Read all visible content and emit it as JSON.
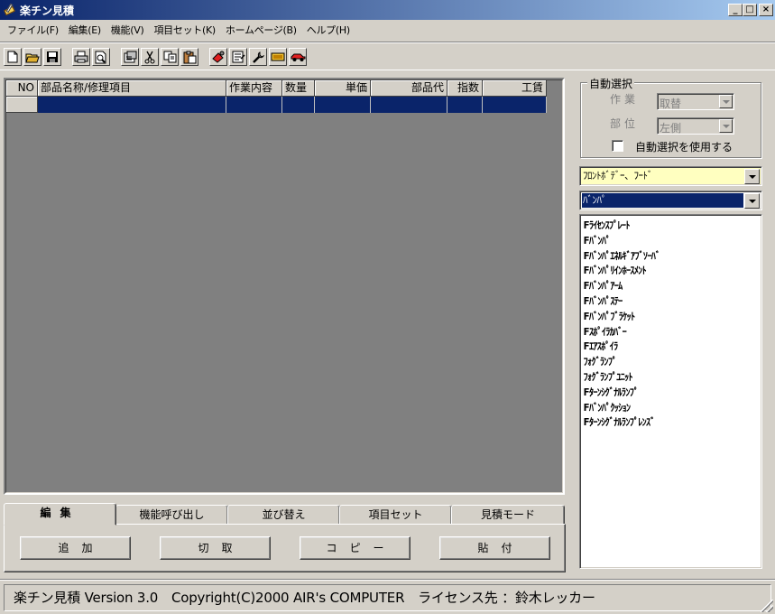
{
  "window": {
    "title": "楽チン見積",
    "minimize": "_",
    "maximize": "□",
    "close": "×"
  },
  "menu": [
    "ファイル(F)",
    "編集(E)",
    "機能(V)",
    "項目セット(K)",
    "ホームページ(B)",
    "ヘルプ(H)"
  ],
  "toolbar": {
    "icons": [
      "new-file-icon",
      "open-folder-icon",
      "save-disk-icon",
      "print-icon",
      "print-preview-icon",
      "properties-icon",
      "cut-icon",
      "copy-icon",
      "paste-icon",
      "paint-icon",
      "form-icon",
      "tool-wrench-icon",
      "price-icon",
      "car-icon"
    ]
  },
  "grid": {
    "columns": [
      "NO",
      "部品名称/修理項目",
      "作業内容",
      "数量",
      "単価",
      "部品代",
      "指数",
      "工賃"
    ]
  },
  "auto_select": {
    "title": "自動選択",
    "work_label": "作業",
    "work_value": "取替",
    "position_label": "部位",
    "position_value": "左側",
    "checkbox_label": "自動選択を使用する"
  },
  "category_combo": "ﾌﾛﾝﾄﾎﾞﾃﾞｰ、ﾌｰﾄﾞ",
  "sub_combo": "ﾊﾞﾝﾊﾟ",
  "parts_list": [
    "Fﾗｲｾﾝｽﾌﾟﾚｰﾄ",
    "Fﾊﾞﾝﾊﾟ",
    "Fﾊﾞﾝﾊﾟｴﾈﾙｷﾞｱﾌﾞｿｰﾊﾞ",
    "Fﾊﾞﾝﾊﾟﾘｲﾝﾎｰｽﾒﾝﾄ",
    "Fﾊﾞﾝﾊﾟｱｰﾑ",
    "Fﾊﾞﾝﾊﾟｽﾃｰ",
    "Fﾊﾞﾝﾊﾟﾌﾞﾗｹｯﾄ",
    "Fｽﾎﾟｲﾗｶﾊﾞｰ",
    "Fｴｱｽﾎﾟｲﾗ",
    "ﾌｫｸﾞﾗﾝﾌﾟ",
    "ﾌｫｸﾞﾗﾝﾌﾟﾕﾆｯﾄ",
    "Fﾀｰﾝｼｸﾞﾅﾙﾗﾝﾌﾟ",
    "Fﾊﾞﾝﾊﾟｸｯｼｮﾝ",
    "Fﾀｰﾝｼｸﾞﾅﾙﾗﾝﾌﾟﾚﾝｽﾞ"
  ],
  "tabs": [
    "編集",
    "機能呼び出し",
    "並び替え",
    "項目セット",
    "見積モード"
  ],
  "actions": [
    "追加",
    "切取",
    "コピー",
    "貼付"
  ],
  "status": "楽チン見積 Version 3.0　Copyright(C)2000 AIR's COMPUTER　ライセンス先 ：鈴木レッカー",
  "colors": {
    "titlebar_start": "#0a246a",
    "titlebar_end": "#a6caf0",
    "selection": "#0a246a",
    "combo_highlight": "#ffffc0",
    "workspace": "#808080"
  }
}
